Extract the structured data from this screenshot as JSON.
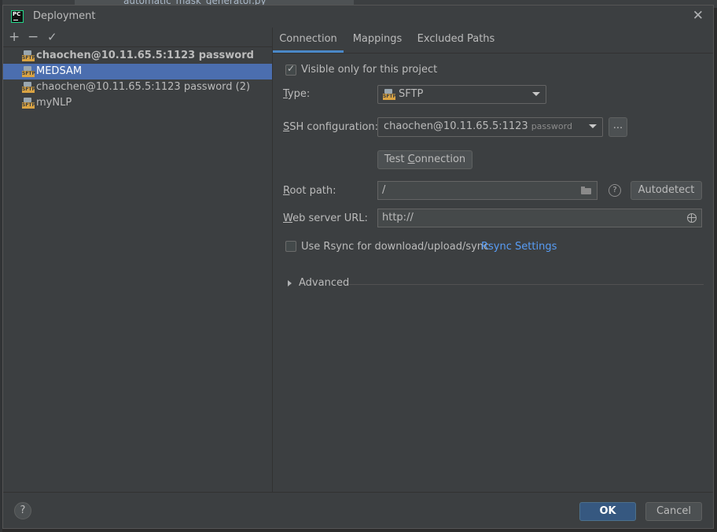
{
  "background": {
    "tab_file": "automatic_mask_generator.py"
  },
  "dialog": {
    "title": "Deployment",
    "app_icon": "PC"
  },
  "toolbar": {
    "add": "+",
    "remove": "−",
    "apply": "✓"
  },
  "servers": [
    {
      "name": "chaochen@10.11.65.5:1123 password",
      "bold": true,
      "selected": false,
      "icon": "sftp-icon"
    },
    {
      "name": "MEDSAM",
      "bold": false,
      "selected": true,
      "icon": "sftp-icon"
    },
    {
      "name": "chaochen@10.11.65.5:1123 password (2)",
      "bold": false,
      "selected": false,
      "icon": "sftp-icon"
    },
    {
      "name": "myNLP",
      "bold": false,
      "selected": false,
      "icon": "sftp-icon"
    }
  ],
  "sftp_badge": "SFTP",
  "tabs": {
    "connection": "Connection",
    "mappings": "Mappings",
    "excluded": "Excluded Paths"
  },
  "connection": {
    "visible_only_label": "Visible only for this project",
    "visible_only_checked": true,
    "type_label_first": "T",
    "type_label_rest": "ype:",
    "type_value": "SFTP",
    "ssh_label_first": "S",
    "ssh_label_rest": "SH configuration:",
    "ssh_value": "chaochen@10.11.65.5:1123",
    "ssh_hint": "password",
    "ssh_more": "...",
    "test_btn_pre": "Test ",
    "test_btn_u": "C",
    "test_btn_post": "onnection",
    "root_label_first": "R",
    "root_label_rest": "oot path:",
    "root_value": "/",
    "root_help": "?",
    "autodetect": "Autodetect",
    "web_label_first": "W",
    "web_label_rest": "eb server URL:",
    "web_value": "http://",
    "rsync_label": "Use Rsync for download/upload/sync",
    "rsync_checked": false,
    "rsync_link": "Rsync Settings",
    "advanced": "Advanced"
  },
  "footer": {
    "help": "?",
    "ok": "OK",
    "cancel": "Cancel"
  }
}
